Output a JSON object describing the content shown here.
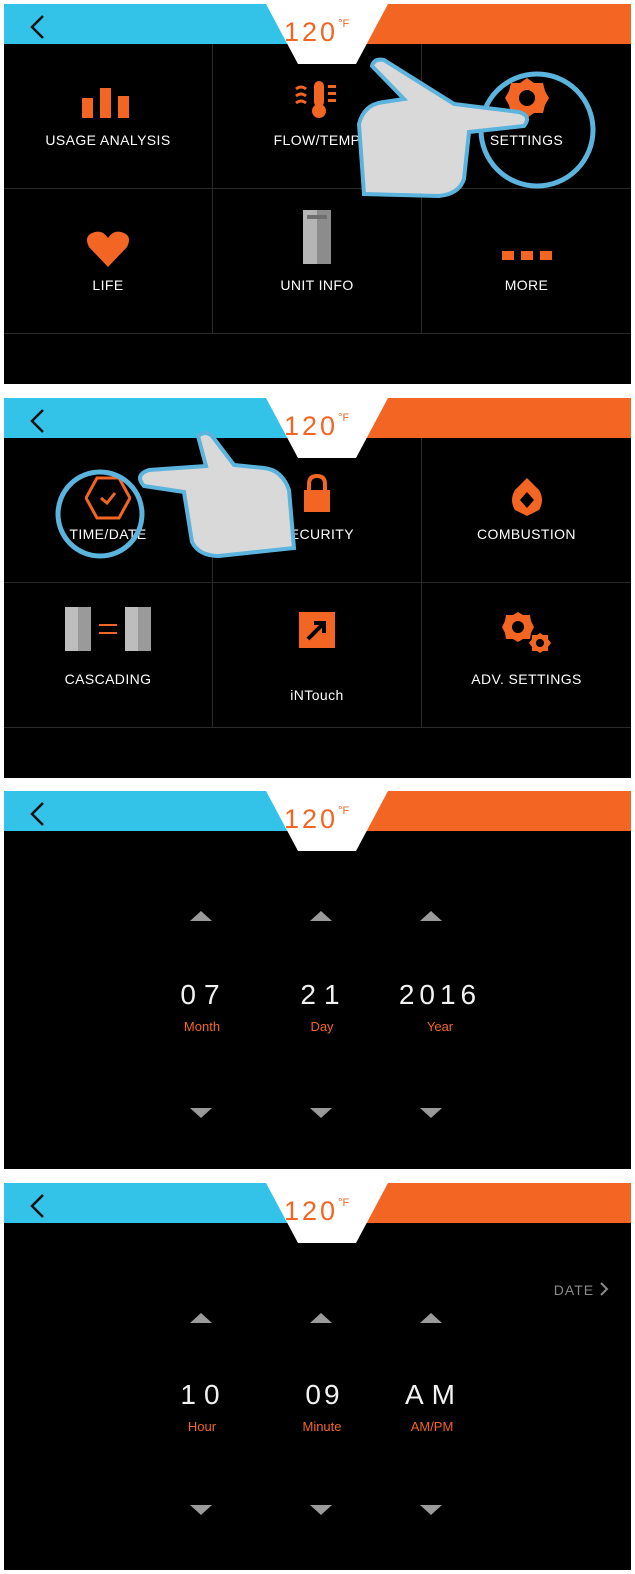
{
  "header": {
    "temperature": "120",
    "unit": "°F",
    "colors": {
      "left_bar": "#34c3e8",
      "right_bar": "#f26522",
      "accent": "#f26522"
    }
  },
  "main_menu": {
    "items": [
      {
        "label": "USAGE ANALYSIS",
        "icon": "bar-chart-icon"
      },
      {
        "label": "FLOW/TEMP",
        "icon": "thermometer-icon"
      },
      {
        "label": "SETTINGS",
        "icon": "gear-icon"
      },
      {
        "label": "LIFE",
        "icon": "heart-icon"
      },
      {
        "label": "UNIT INFO",
        "icon": "unit-cabinet-icon"
      },
      {
        "label": "MORE",
        "icon": "more-dots-icon"
      }
    ]
  },
  "settings_menu": {
    "items": [
      {
        "label": "TIME/DATE",
        "icon": "clock-icon"
      },
      {
        "label": "SECURITY",
        "icon": "lock-icon"
      },
      {
        "label": "COMBUSTION",
        "icon": "flame-icon"
      },
      {
        "label": "CASCADING",
        "icon": "cascading-units-icon"
      },
      {
        "label": "iNTouch",
        "icon": "external-link-icon"
      },
      {
        "label": "ADV. SETTINGS",
        "icon": "gears-icon"
      }
    ]
  },
  "date_screen": {
    "fields": [
      {
        "value": "07",
        "label": "Month"
      },
      {
        "value": "21",
        "label": "Day"
      },
      {
        "value": "2016",
        "label": "Year"
      }
    ]
  },
  "time_screen": {
    "date_link": "DATE",
    "fields": [
      {
        "value": "10",
        "label": "Hour"
      },
      {
        "value": "09",
        "label": "Minute"
      },
      {
        "value": "AM",
        "label": "AM/PM"
      }
    ]
  }
}
